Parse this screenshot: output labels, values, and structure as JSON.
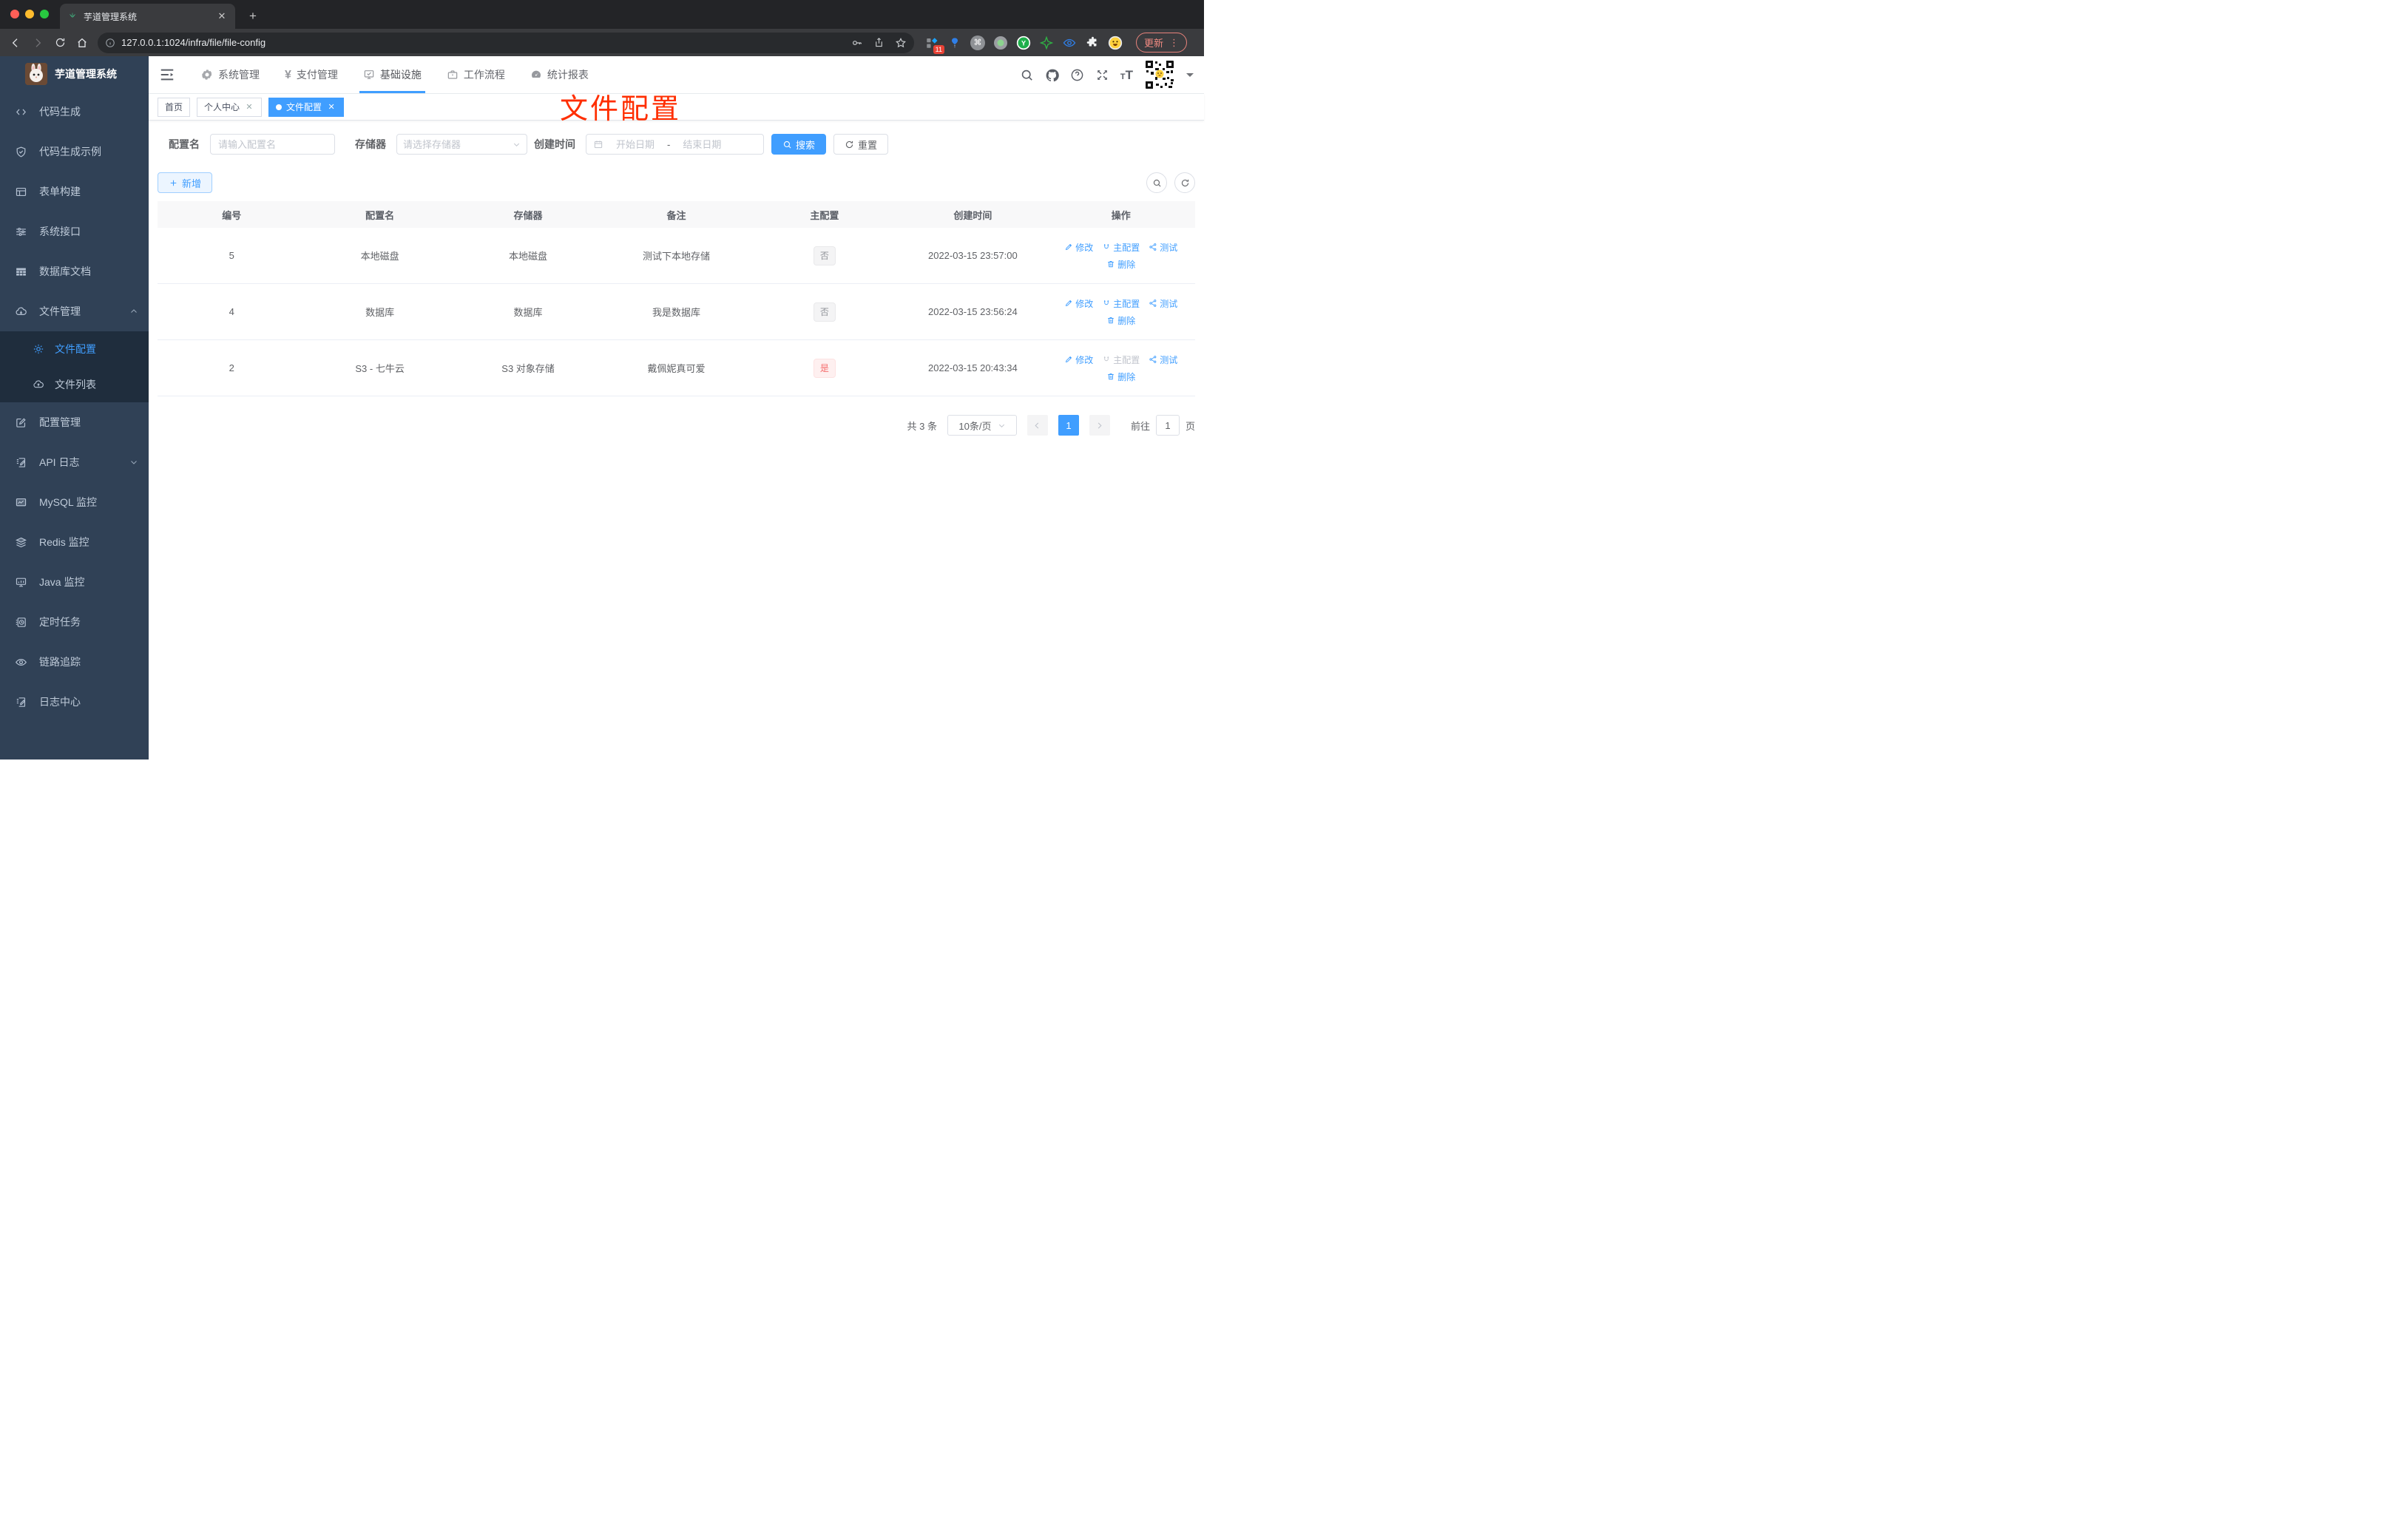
{
  "browser": {
    "tab_title": "芋道管理系统",
    "url": "127.0.0.1:1024/infra/file/file-config",
    "update_label": "更新",
    "extension_badge": "11"
  },
  "sidebar": {
    "title": "芋道管理系统",
    "items": [
      {
        "label": "代码生成",
        "icon": "code-icon"
      },
      {
        "label": "代码生成示例",
        "icon": "shield-check-icon"
      },
      {
        "label": "表单构建",
        "icon": "form-icon"
      },
      {
        "label": "系统接口",
        "icon": "sliders-icon"
      },
      {
        "label": "数据库文档",
        "icon": "grid-icon"
      },
      {
        "label": "文件管理",
        "icon": "cloud-download-icon"
      },
      {
        "label": "配置管理",
        "icon": "edit-icon"
      },
      {
        "label": "API 日志",
        "icon": "doc-edit-icon"
      },
      {
        "label": "MySQL 监控",
        "icon": "chart-monitor-icon"
      },
      {
        "label": "Redis 监控",
        "icon": "layers-icon"
      },
      {
        "label": "Java 监控",
        "icon": "screen-icon"
      },
      {
        "label": "定时任务",
        "icon": "timer-icon"
      },
      {
        "label": "链路追踪",
        "icon": "eye-icon"
      },
      {
        "label": "日志中心",
        "icon": "doc-edit-icon"
      }
    ],
    "file_submenu": [
      {
        "label": "文件配置",
        "icon": "gear-icon"
      },
      {
        "label": "文件列表",
        "icon": "cloud-upload-icon"
      }
    ]
  },
  "topnav": {
    "menus": [
      {
        "label": "系统管理",
        "icon": "gear-icon"
      },
      {
        "label": "支付管理",
        "icon": "yen-icon"
      },
      {
        "label": "基础设施",
        "icon": "monitor-check-icon"
      },
      {
        "label": "工作流程",
        "icon": "briefcase-icon"
      },
      {
        "label": "统计报表",
        "icon": "dashboard-icon"
      }
    ]
  },
  "tags": {
    "items": [
      {
        "label": "首页"
      },
      {
        "label": "个人中心"
      },
      {
        "label": "文件配置"
      }
    ]
  },
  "overlay_title": "文件配置",
  "filter": {
    "name_label": "配置名",
    "name_placeholder": "请输入配置名",
    "storage_label": "存储器",
    "storage_placeholder": "请选择存储器",
    "date_label": "创建时间",
    "date_start_placeholder": "开始日期",
    "date_separator": "-",
    "date_end_placeholder": "结束日期",
    "search_label": "搜索",
    "reset_label": "重置"
  },
  "toolbar": {
    "add_label": "新增"
  },
  "table": {
    "headers": [
      "编号",
      "配置名",
      "存储器",
      "备注",
      "主配置",
      "创建时间",
      "操作"
    ],
    "actions": {
      "edit": "修改",
      "master": "主配置",
      "test": "测试",
      "delete": "删除"
    },
    "rows": [
      {
        "id": "5",
        "name": "本地磁盘",
        "storage": "本地磁盘",
        "remark": "测试下本地存储",
        "master": "否",
        "created": "2022-03-15 23:57:00"
      },
      {
        "id": "4",
        "name": "数据库",
        "storage": "数据库",
        "remark": "我是数据库",
        "master": "否",
        "created": "2022-03-15 23:56:24"
      },
      {
        "id": "2",
        "name": "S3 - 七牛云",
        "storage": "S3 对象存储",
        "remark": "戴佩妮真可爱",
        "master": "是",
        "created": "2022-03-15 20:43:34"
      }
    ]
  },
  "pagination": {
    "total_text": "共 3 条",
    "page_size": "10条/页",
    "current_page": "1",
    "goto_label": "前往",
    "goto_value": "1",
    "page_unit": "页"
  },
  "colors": {
    "primary": "#409eff",
    "sidebar_bg": "#304156",
    "submenu_bg": "#1f2d3d",
    "danger": "#f56c6c",
    "overlay_red": "#ff2e00"
  }
}
